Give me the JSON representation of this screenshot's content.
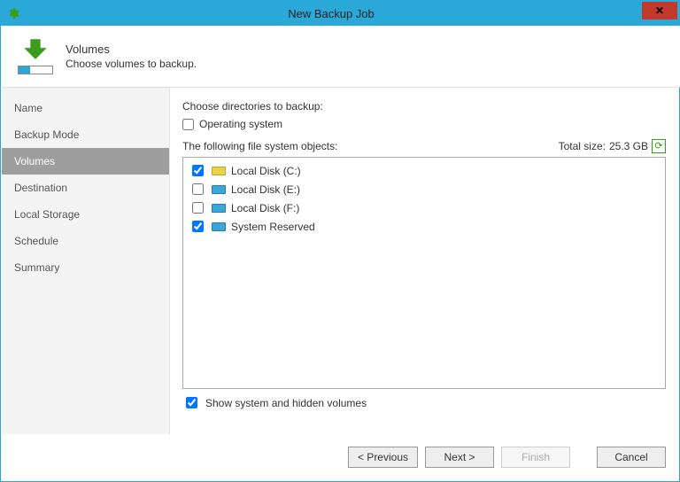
{
  "window": {
    "title": "New Backup Job"
  },
  "header": {
    "title": "Volumes",
    "subtitle": "Choose volumes to backup."
  },
  "sidebar": {
    "steps": [
      {
        "label": "Name"
      },
      {
        "label": "Backup Mode"
      },
      {
        "label": "Volumes"
      },
      {
        "label": "Destination"
      },
      {
        "label": "Local Storage"
      },
      {
        "label": "Schedule"
      },
      {
        "label": "Summary"
      }
    ],
    "active_index": 2
  },
  "main": {
    "choose_dirs_label": "Choose directories to backup:",
    "os_checkbox_label": "Operating system",
    "os_checkbox_checked": false,
    "list_header": "The following file system objects:",
    "total_size_label": "Total size:",
    "total_size_value": "25.3 GB",
    "volumes": [
      {
        "label": "Local Disk (C:)",
        "checked": true,
        "primary": true
      },
      {
        "label": "Local Disk (E:)",
        "checked": false,
        "primary": false
      },
      {
        "label": "Local Disk (F:)",
        "checked": false,
        "primary": false
      },
      {
        "label": "System Reserved",
        "checked": true,
        "primary": false
      }
    ],
    "show_system_label": "Show system and hidden volumes",
    "show_system_checked": true
  },
  "buttons": {
    "previous": "< Previous",
    "next": "Next >",
    "finish": "Finish",
    "cancel": "Cancel"
  }
}
